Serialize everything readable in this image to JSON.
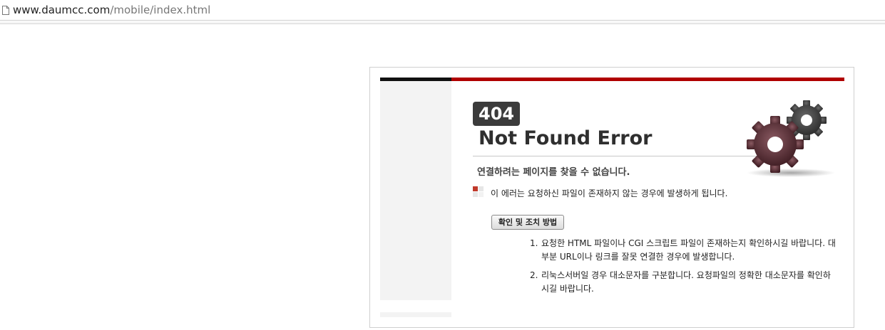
{
  "browser": {
    "url_domain": "www.daumcc.com",
    "url_path": "/mobile/index.html",
    "page_icon": "document-icon"
  },
  "error": {
    "code": "404",
    "title": "Not Found Error",
    "subtitle": "연결하려는 페이지를 찾을 수 없습니다.",
    "description": "이 에러는 요청하신 파일이 존재하지 않는 경우에 발생하게 됩니다.",
    "guide_button": "확인 및 조치 방법",
    "gear_icon": "gears-icon",
    "steps": [
      {
        "num": "1.",
        "text": "요청한 HTML 파일이나 CGI 스크립트 파일이 존재하는지 확인하시길 바랍니다. 대부분 URL이나 링크를 잘못 연결한 경우에 발생합니다."
      },
      {
        "num": "2.",
        "text": "리눅스서버일 경우 대소문자를 구분합니다. 요청파일의 정확한 대소문자를 확인하시길 바랍니다."
      }
    ]
  },
  "colors": {
    "accent_red": "#b00000",
    "accent_black": "#111111",
    "badge": "#3b3b3b"
  }
}
